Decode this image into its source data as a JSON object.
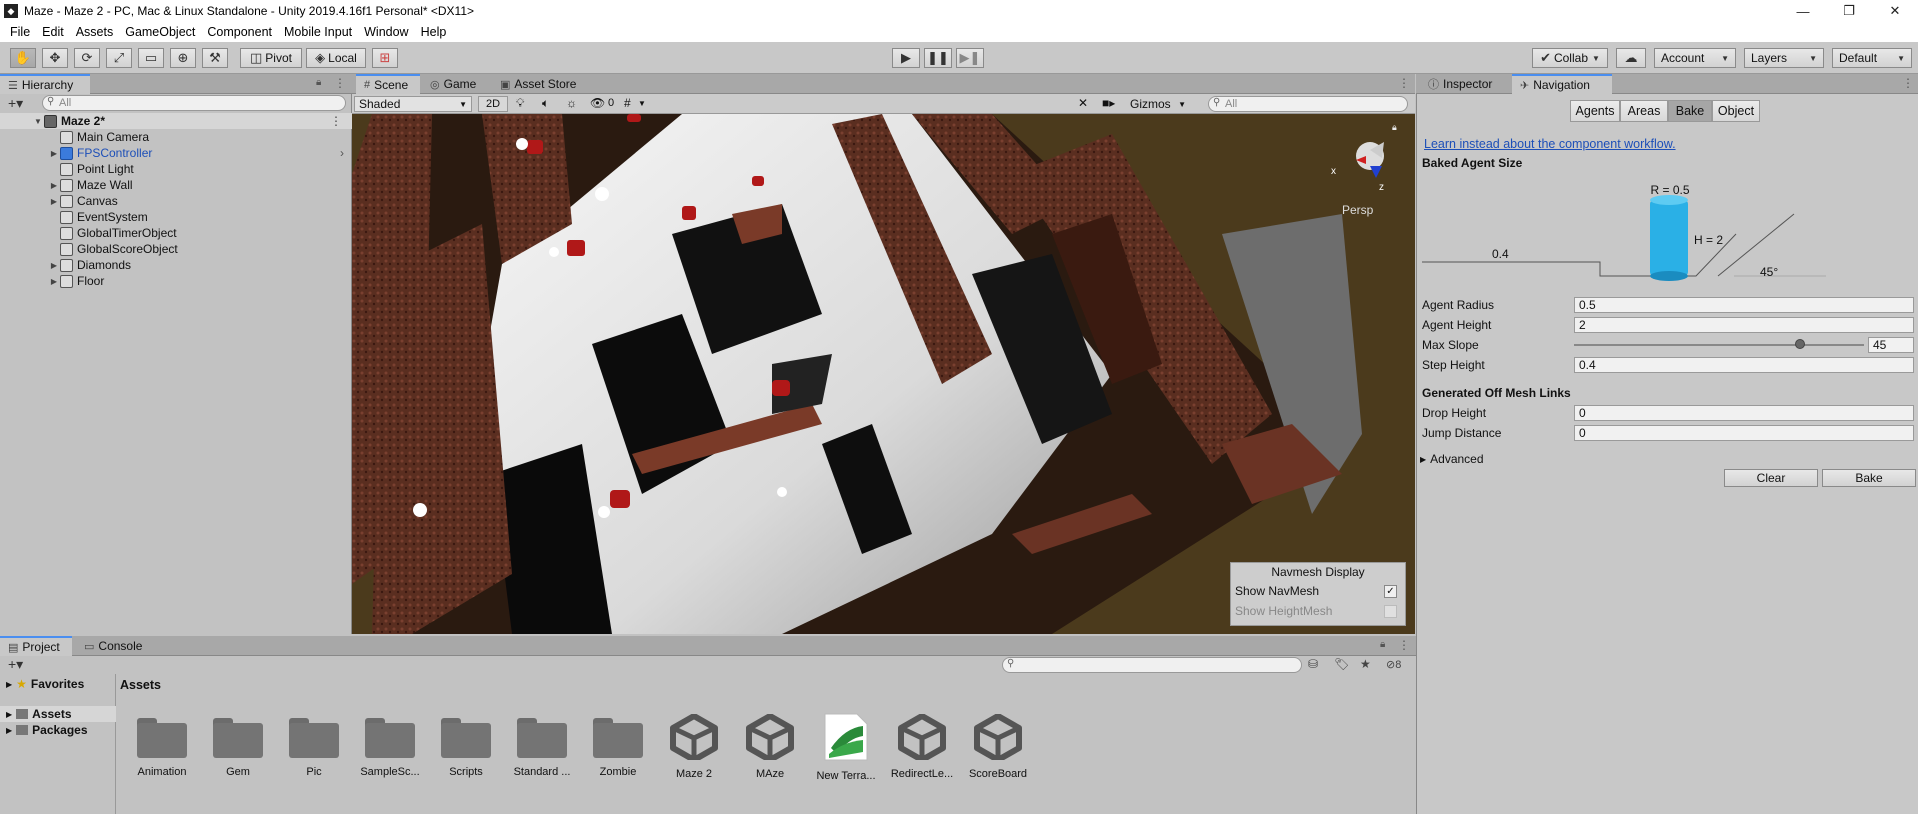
{
  "window": {
    "title": "Maze - Maze 2 - PC, Mac & Linux Standalone - Unity 2019.4.16f1 Personal* <DX11>",
    "minimize": "—",
    "maximize": "❐",
    "close": "✕"
  },
  "menu": [
    "File",
    "Edit",
    "Assets",
    "GameObject",
    "Component",
    "Mobile Input",
    "Window",
    "Help"
  ],
  "toolbar": {
    "pivot": "Pivot",
    "local": "Local",
    "collab": "Collab",
    "account": "Account",
    "layers": "Layers",
    "layout": "Default"
  },
  "hierarchy": {
    "tab": "Hierarchy",
    "search_placeholder": "All",
    "scene": "Maze 2*",
    "items": [
      {
        "label": "Main Camera",
        "expandable": false
      },
      {
        "label": "FPSController",
        "expandable": true
      },
      {
        "label": "Point Light",
        "expandable": false
      },
      {
        "label": "Maze Wall",
        "expandable": true
      },
      {
        "label": "Canvas",
        "expandable": true
      },
      {
        "label": "EventSystem",
        "expandable": false
      },
      {
        "label": "GlobalTimerObject",
        "expandable": false
      },
      {
        "label": "GlobalScoreObject",
        "expandable": false
      },
      {
        "label": "Diamonds",
        "expandable": true
      },
      {
        "label": "Floor",
        "expandable": true
      }
    ]
  },
  "scene_tabs": [
    "Scene",
    "Game",
    "Asset Store"
  ],
  "scene_toolbar": {
    "shading": "Shaded",
    "mode_2d": "2D",
    "hidden_count": "0",
    "gizmos": "Gizmos",
    "search_placeholder": "All",
    "persp": "Persp",
    "axis_x": "x",
    "axis_z": "z"
  },
  "navmesh_display": {
    "title": "Navmesh Display",
    "show_navmesh": "Show NavMesh",
    "show_heightmesh": "Show HeightMesh",
    "show_navmesh_checked": true,
    "show_heightmesh_checked": false
  },
  "inspector": {
    "tabs": [
      "Inspector",
      "Navigation"
    ],
    "subtabs": [
      "Agents",
      "Areas",
      "Bake",
      "Object"
    ],
    "selected_subtab": "Bake",
    "link": "Learn instead about the component workflow.",
    "baked_agent_size": "Baked Agent Size",
    "diagram": {
      "radius": "R = 0.5",
      "height": "H = 2",
      "step": "0.4",
      "slope": "45°"
    },
    "fields": [
      {
        "label": "Agent Radius",
        "value": "0.5"
      },
      {
        "label": "Agent Height",
        "value": "2"
      },
      {
        "label": "Max Slope",
        "value": "45",
        "slider_fraction": 0.78
      },
      {
        "label": "Step Height",
        "value": "0.4"
      }
    ],
    "generated_links_title": "Generated Off Mesh Links",
    "link_fields": [
      {
        "label": "Drop Height",
        "value": "0"
      },
      {
        "label": "Jump Distance",
        "value": "0"
      }
    ],
    "advanced": "Advanced",
    "clear": "Clear",
    "bake": "Bake"
  },
  "project": {
    "tabs": [
      "Project",
      "Console"
    ],
    "favorites": "Favorites",
    "assets_root": "Assets",
    "packages": "Packages",
    "breadcrumb": "Assets",
    "hidden_count": "8",
    "items": [
      {
        "label": "Animation",
        "kind": "folder"
      },
      {
        "label": "Gem",
        "kind": "folder"
      },
      {
        "label": "Pic",
        "kind": "folder"
      },
      {
        "label": "SampleSc...",
        "kind": "folder"
      },
      {
        "label": "Scripts",
        "kind": "folder"
      },
      {
        "label": "Standard ...",
        "kind": "folder"
      },
      {
        "label": "Zombie",
        "kind": "folder"
      },
      {
        "label": "Maze 2",
        "kind": "unity"
      },
      {
        "label": "MAze",
        "kind": "unity"
      },
      {
        "label": "New Terra...",
        "kind": "terrain"
      },
      {
        "label": "RedirectLe...",
        "kind": "unity"
      },
      {
        "label": "ScoreBoard",
        "kind": "unity"
      }
    ]
  }
}
